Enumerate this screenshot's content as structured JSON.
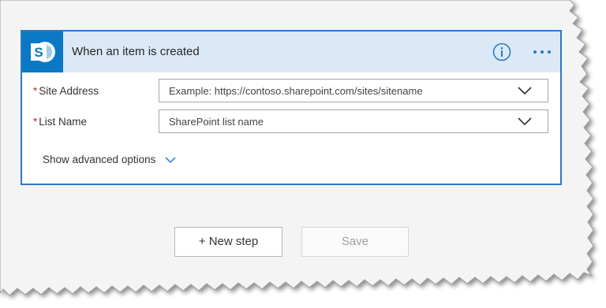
{
  "trigger_card": {
    "title": "When an item is created",
    "connector_icon": "sharepoint-icon",
    "connector_icon_letter": "S",
    "info_icon": "info-icon",
    "more_icon": "more-options-icon",
    "accent_color": "#2b79c2",
    "header_color": "#dbe9f6",
    "fields": [
      {
        "label": "Site Address",
        "required_marker": "*",
        "placeholder": "Example: https://contoso.sharepoint.com/sites/sitename",
        "dropdown_icon": "chevron-down-icon"
      },
      {
        "label": "List Name",
        "required_marker": "*",
        "placeholder": "SharePoint list name",
        "dropdown_icon": "chevron-down-icon"
      }
    ],
    "advanced_options_label": "Show advanced options"
  },
  "footer": {
    "new_step_label": "+ New step",
    "save_label": "Save"
  }
}
